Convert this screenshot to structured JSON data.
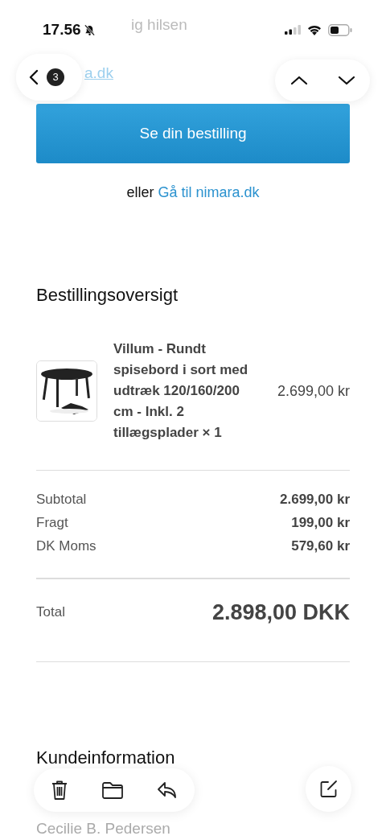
{
  "status_bar": {
    "time": "17.56",
    "silenced": true
  },
  "email": {
    "greeting_fragment": "ig hilsen",
    "link_fragment": "a.dk",
    "primary_button": "Se din bestilling",
    "alt_prefix": "eller",
    "alt_link": "Gå til nimara.dk",
    "summary_heading": "Bestillingsoversigt",
    "items": [
      {
        "title": "Villum - Rundt spisebord i sort med udtræk 120/160/200 cm - Inkl. 2 tillægsplader × 1",
        "price": "2.699,00 kr"
      }
    ],
    "lines": [
      {
        "label": "Subtotal",
        "value": "2.699,00 kr"
      },
      {
        "label": "Fragt",
        "value": "199,00 kr"
      },
      {
        "label": "DK Moms",
        "value": "579,60 kr"
      }
    ],
    "total": {
      "label": "Total",
      "value": "2.898,00 DKK"
    },
    "customer_heading": "Kundeinformation",
    "customer_name": "Cecilie B. Pedersen"
  },
  "nav": {
    "unread_count": "3"
  }
}
